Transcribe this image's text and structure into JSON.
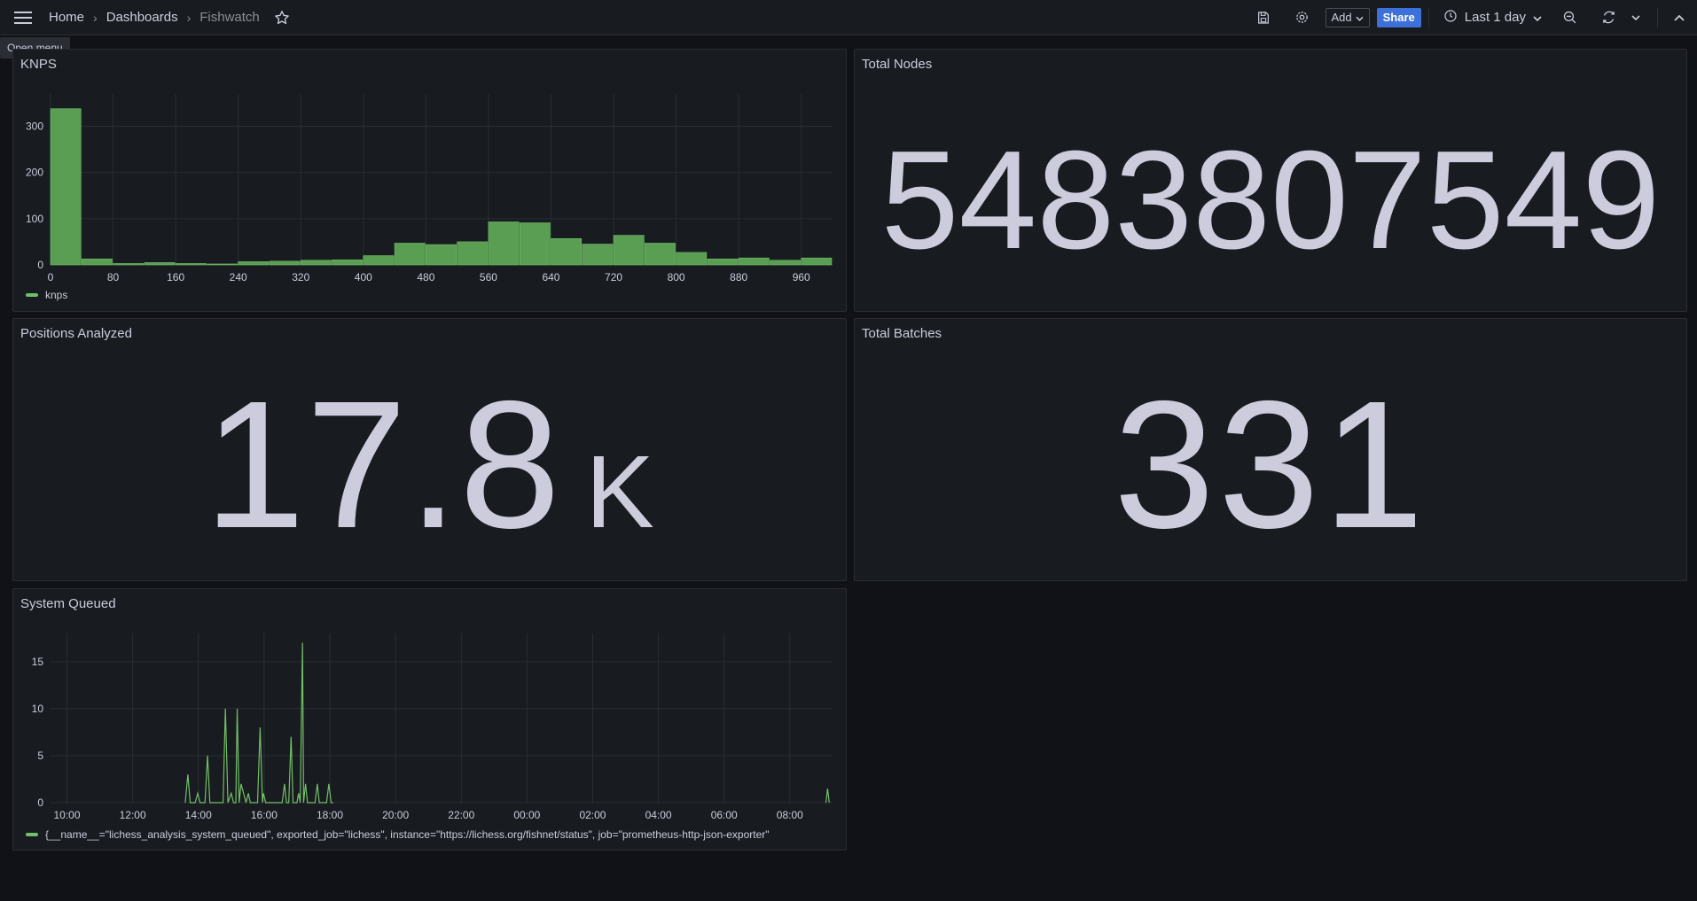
{
  "topbar": {
    "breadcrumbs": [
      "Home",
      "Dashboards",
      "Fishwatch"
    ],
    "tooltip": "Open menu",
    "add_label": "Add",
    "share_label": "Share",
    "time_range": "Last 1 day",
    "icons": [
      "menu-icon",
      "star-icon",
      "save-icon",
      "gear-icon",
      "clock-icon",
      "zoom-out-icon",
      "refresh-icon",
      "chevron-down-icon",
      "chevron-up-icon"
    ]
  },
  "panels": {
    "knps": {
      "title": "KNPS",
      "legend": "knps"
    },
    "total_nodes": {
      "title": "Total Nodes",
      "value": "5483807549"
    },
    "positions": {
      "title": "Positions Analyzed",
      "value": "17.8",
      "unit": "K"
    },
    "total_batches": {
      "title": "Total Batches",
      "value": "331"
    },
    "system_queued": {
      "title": "System Queued",
      "legend": "{__name__=\"lichess_analysis_system_queued\", exported_job=\"lichess\", instance=\"https://lichess.org/fishnet/status\", job=\"prometheus-http-json-exporter\""
    }
  },
  "colors": {
    "series": "#73bf69",
    "bar_fill": "#5a9e54",
    "background": "#111217",
    "panel": "#181b1f",
    "accent": "#3d71d9"
  },
  "chart_data": [
    {
      "type": "bar",
      "title": "KNPS",
      "bin_width": 40,
      "x": [
        0,
        40,
        80,
        120,
        160,
        200,
        240,
        280,
        320,
        360,
        400,
        440,
        480,
        520,
        560,
        600,
        640,
        680,
        720,
        760,
        800,
        840,
        880,
        920,
        960
      ],
      "values": [
        338,
        13,
        3,
        5,
        3,
        2,
        7,
        8,
        10,
        11,
        20,
        47,
        44,
        50,
        93,
        91,
        57,
        45,
        64,
        47,
        27,
        13,
        15,
        10,
        15
      ],
      "xticks": [
        "0",
        "80",
        "160",
        "240",
        "320",
        "400",
        "480",
        "560",
        "640",
        "720",
        "800",
        "880",
        "960"
      ],
      "yticks": [
        "0",
        "100",
        "200",
        "300"
      ],
      "xlim": [
        0,
        1000
      ],
      "ylim": [
        0,
        370
      ],
      "series": [
        {
          "name": "knps"
        }
      ],
      "legend": "bottom-left",
      "grid": true
    },
    {
      "type": "line",
      "title": "System Queued",
      "xticks": [
        "10:00",
        "12:00",
        "14:00",
        "16:00",
        "18:00",
        "20:00",
        "22:00",
        "00:00",
        "02:00",
        "04:00",
        "06:00",
        "08:00"
      ],
      "yticks": [
        "0",
        "5",
        "10",
        "15"
      ],
      "x_hours": [
        9.5,
        13.6,
        13.68,
        13.75,
        13.9,
        13.98,
        14.05,
        14.2,
        14.28,
        14.35,
        14.75,
        14.82,
        14.9,
        15.0,
        15.07,
        15.14,
        15.18,
        15.24,
        15.3,
        15.45,
        15.52,
        15.58,
        15.8,
        15.88,
        15.95,
        15.98,
        16.05,
        16.12,
        16.55,
        16.62,
        16.68,
        16.75,
        16.82,
        16.88,
        17.0,
        17.05,
        17.1,
        17.17,
        17.2,
        17.26,
        17.32,
        17.55,
        17.62,
        17.68,
        17.9,
        17.97,
        18.04,
        18.1,
        33.1,
        33.15,
        33.2
      ],
      "y": [
        0,
        0,
        3,
        0,
        0,
        1,
        0,
        0,
        5,
        0,
        0,
        10,
        0,
        1,
        0,
        0,
        10,
        0,
        2,
        0,
        1,
        0,
        0,
        8,
        0,
        1,
        0,
        0,
        0,
        2,
        0,
        0,
        7,
        0,
        0,
        1,
        0,
        17,
        0,
        2,
        0,
        0,
        2,
        0,
        0,
        2,
        0,
        0,
        0,
        1.5,
        0
      ],
      "ylim": [
        0,
        18
      ],
      "xlim_hours": [
        9.5,
        33.3
      ],
      "series": [
        {
          "name": "{__name__=\"lichess_analysis_system_queued\", exported_job=\"lichess\", instance=\"https://lichess.org/fishnet/status\", job=\"prometheus-http-json-exporter\""
        }
      ],
      "legend": "bottom-left",
      "grid": true
    }
  ]
}
